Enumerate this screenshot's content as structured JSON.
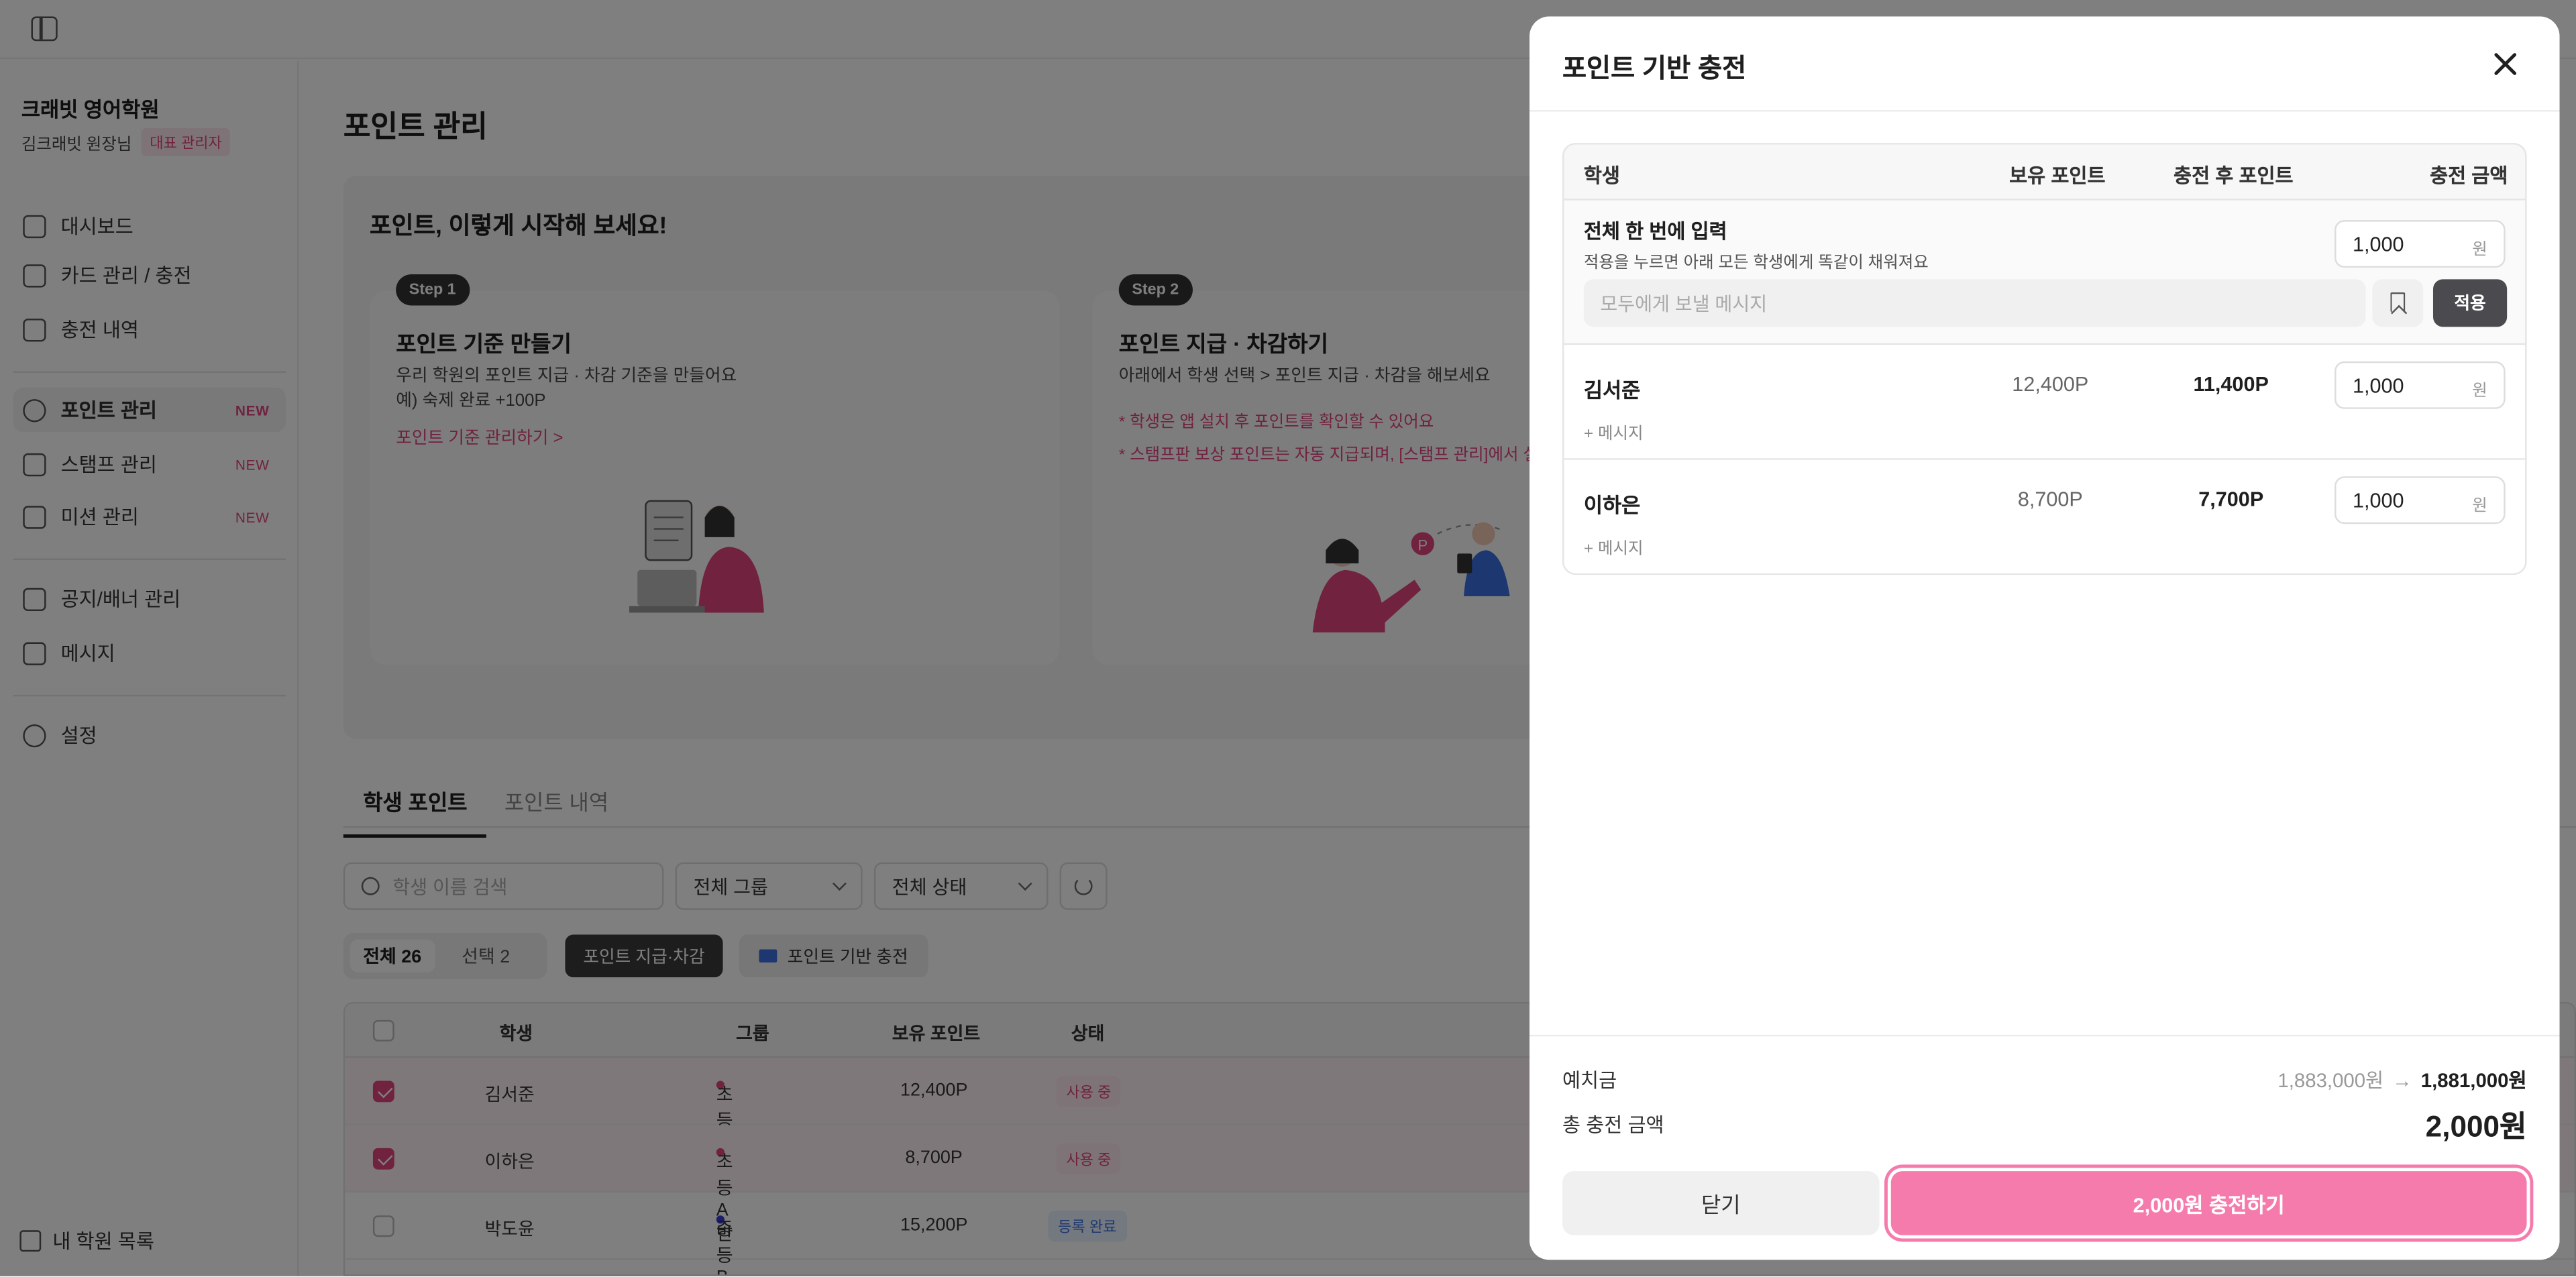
{
  "sidebar": {
    "academy_name": "크래빗 영어학원",
    "owner_name": "김크래빗 원장님",
    "owner_role": "대표 관리자",
    "items": [
      {
        "label": "대시보드",
        "icon": "home-icon"
      },
      {
        "label": "카드 관리 / 충전",
        "icon": "wallet-icon"
      },
      {
        "label": "충전 내역",
        "icon": "receipt-icon"
      },
      {
        "label": "포인트 관리",
        "icon": "point-icon",
        "badge": "NEW",
        "active": true
      },
      {
        "label": "스탬프 관리",
        "icon": "star-icon",
        "badge": "NEW"
      },
      {
        "label": "미션 관리",
        "icon": "flag-icon",
        "badge": "NEW"
      },
      {
        "label": "공지/배너 관리",
        "icon": "megaphone-icon"
      },
      {
        "label": "메시지",
        "icon": "mail-icon"
      },
      {
        "label": "설정",
        "icon": "gear-icon"
      }
    ],
    "bottom_link": "내 학원 목록"
  },
  "main": {
    "title": "포인트 관리",
    "guide": {
      "title": "포인트, 이렇게 시작해 보세요!",
      "step1": {
        "badge": "Step 1",
        "heading": "포인트 기준 만들기",
        "desc1": "우리 학원의 포인트 지급 · 차감 기준을 만들어요",
        "desc2": "예) 숙제 완료 +100P",
        "link": "포인트 기준 관리하기 >"
      },
      "step2": {
        "badge": "Step 2",
        "heading": "포인트 지급 · 차감하기",
        "desc1": "아래에서 학생 선택 > 포인트 지급 · 차감을 해보세요",
        "note1": "* 학생은 앱 설치 후 포인트를 확인할 수 있어요",
        "note2": "* 스탬프판 보상 포인트는 자동 지급되며, [스탬프 관리]에서 설"
      }
    },
    "tabs": [
      "학생 포인트",
      "포인트 내역"
    ],
    "search_placeholder": "학생 이름 검색",
    "filter_group": "전체 그룹",
    "filter_status": "전체 상태",
    "seg_all": "전체 26",
    "seg_selected": "선택 2",
    "btn_grant": "포인트 지급·차감",
    "btn_charge": "포인트 기반 충전",
    "table": {
      "headers": [
        "학생",
        "그룹",
        "보유 포인트",
        "상태"
      ],
      "rows": [
        {
          "name": "김서준",
          "group": "초등A반",
          "points": "12,400P",
          "status": "사용 중",
          "selected": true
        },
        {
          "name": "이하은",
          "group": "초등A반",
          "points": "8,700P",
          "status": "사용 중",
          "selected": true
        },
        {
          "name": "박도윤",
          "group": "중등B반",
          "points": "15,200P",
          "status": "등록 완료",
          "selected": false
        }
      ]
    }
  },
  "modal": {
    "title": "포인트 기반 충전",
    "headers": {
      "student": "학생",
      "held": "보유 포인트",
      "after": "충전 후 포인트",
      "amount": "충전 금액"
    },
    "bulk": {
      "title": "전체 한 번에 입력",
      "desc": "적용을 누르면 아래 모든 학생에게 똑같이 채워져요",
      "amount": "1,000",
      "unit": "원",
      "message_placeholder": "모두에게 보낼 메시지",
      "apply": "적용"
    },
    "rows": [
      {
        "name": "김서준",
        "held": "12,400P",
        "after": "11,400P",
        "amount": "1,000",
        "unit": "원",
        "message": "+ 메시지"
      },
      {
        "name": "이하은",
        "held": "8,700P",
        "after": "7,700P",
        "amount": "1,000",
        "unit": "원",
        "message": "+ 메시지"
      }
    ],
    "footer": {
      "deposit_label": "예치금",
      "deposit_before": "1,883,000원",
      "deposit_arrow": "→",
      "deposit_after": "1,881,000원",
      "total_label": "총 충전 금액",
      "total": "2,000원",
      "close": "닫기",
      "charge": "2,000원 충전하기"
    }
  },
  "colors": {
    "accent": "#e0457d",
    "charge_button": "#f67bad",
    "dark_button": "#3a3a3c"
  }
}
